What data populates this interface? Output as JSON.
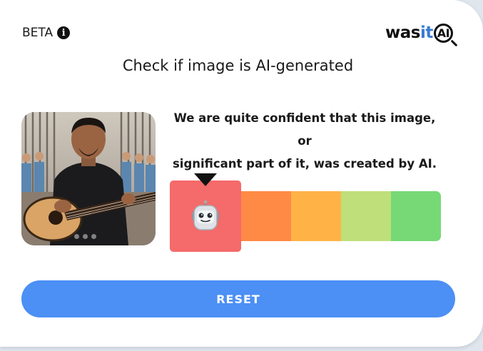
{
  "header": {
    "beta_label": "BETA",
    "info_icon": "info-icon",
    "logo": {
      "was": "was",
      "it": "it",
      "ai": "AI"
    }
  },
  "title": "Check if image is AI-generated",
  "result": {
    "line1": "We are quite confident that this image, or",
    "line2": "significant part of it, was created by AI.",
    "selected_level": 1,
    "levels": 5,
    "selected_icon": "robot-face-icon"
  },
  "scale_colors": [
    "#f56a6a",
    "#ff8a45",
    "#ffb347",
    "#bfdf7a",
    "#76d976"
  ],
  "image": {
    "carousel_dots": 3,
    "icon": "photo-guitar-player"
  },
  "reset_label": "RESET",
  "colors": {
    "accent": "#4c8ff5",
    "logo_it": "#3a7bd5"
  }
}
